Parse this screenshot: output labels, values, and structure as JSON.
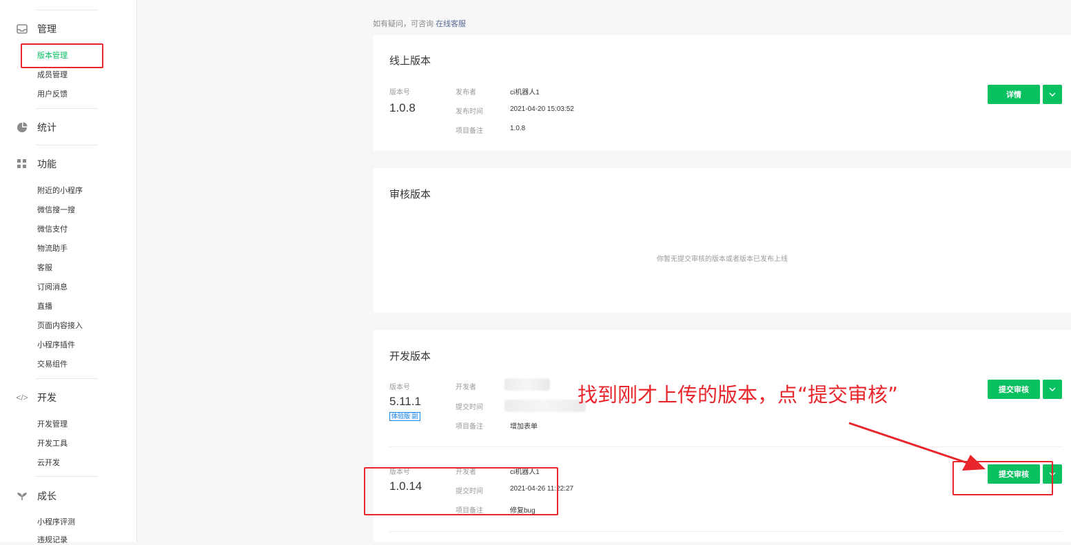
{
  "sidebar": {
    "sections": [
      {
        "label": "管理",
        "icon": "inbox-icon",
        "items": [
          "版本管理",
          "成员管理",
          "用户反馈"
        ]
      },
      {
        "label": "统计",
        "icon": "pie-chart-icon",
        "items": []
      },
      {
        "label": "功能",
        "icon": "grid-icon",
        "items": [
          "附近的小程序",
          "微信搜一搜",
          "微信支付",
          "物流助手",
          "客服",
          "订阅消息",
          "直播",
          "页面内容接入",
          "小程序插件",
          "交易组件"
        ]
      },
      {
        "label": "开发",
        "icon": "code-icon",
        "items": [
          "开发管理",
          "开发工具",
          "云开发"
        ]
      },
      {
        "label": "成长",
        "icon": "sprout-icon",
        "items": [
          "小程序评测",
          "违规记录"
        ]
      }
    ],
    "active_item": "版本管理"
  },
  "hint": {
    "text": "如有疑问，可咨询",
    "link": "在线客服"
  },
  "online": {
    "title": "线上版本",
    "version_label": "版本号",
    "version": "1.0.8",
    "fields": [
      {
        "label": "发布者",
        "value": "ci机器人1"
      },
      {
        "label": "发布时间",
        "value": "2021-04-20 15:03:52"
      },
      {
        "label": "项目备注",
        "value": "1.0.8"
      }
    ],
    "button": "详情"
  },
  "review": {
    "title": "审核版本",
    "empty_text": "你暂无提交审核的版本或者版本已发布上线"
  },
  "dev": {
    "title": "开发版本",
    "rows": [
      {
        "version_label": "版本号",
        "version": "5.11.1",
        "badge": "体验版 副",
        "fields": [
          {
            "label": "开发者",
            "value": ""
          },
          {
            "label": "提交时间",
            "value": ""
          },
          {
            "label": "项目备注",
            "value": "增加表单"
          }
        ],
        "button": "提交审核"
      },
      {
        "version_label": "版本号",
        "version": "1.0.14",
        "fields": [
          {
            "label": "开发者",
            "value": "ci机器人1"
          },
          {
            "label": "提交时间",
            "value": "2021-04-26 11:22:27"
          },
          {
            "label": "项目备注",
            "value": "修复bug"
          }
        ],
        "button": "提交审核"
      }
    ]
  },
  "annotation": "找到刚才上传的版本，点“提交审核”",
  "colors": {
    "accent": "#07c160",
    "annotation": "#e8262b",
    "link": "#576b95"
  }
}
